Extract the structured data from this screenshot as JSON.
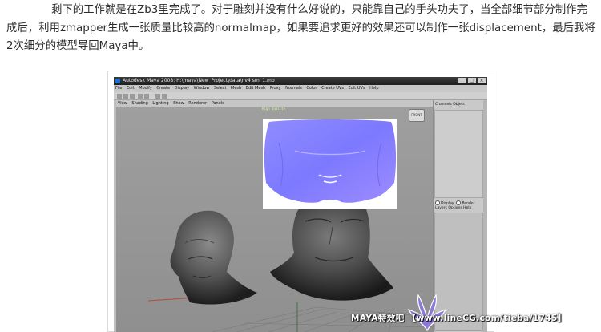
{
  "article": {
    "paragraph": "剩下的工作就是在Zb3里完成了。对于雕刻并没有什么好说的，只能靠自己的手头功夫了，当全部细节部分制作完成后，利用zmapper生成一张质量比较高的normalmap，如果要追求更好的效果还可以制作一张displacement，最后我将2次细分的模型导回Maya中。"
  },
  "maya": {
    "window_title": "Autodesk Maya 2008: H:\\maya\\New_Project\\data\\nv4 sml 1.mb",
    "window_buttons": [
      "_",
      "□",
      "×"
    ],
    "menus": [
      "File",
      "Edit",
      "Modify",
      "Create",
      "Display",
      "Window",
      "Select",
      "Mesh",
      "Edit Mesh",
      "Proxy",
      "Normals",
      "Color",
      "Create UVs",
      "Edit UVs",
      "Help"
    ],
    "panel_menus": [
      "View",
      "Shading",
      "Lighting",
      "Show",
      "Renderer",
      "Panels"
    ],
    "viewport_label": "High Quality",
    "viewcube_label": "FRONT",
    "side_tabs": [
      "Channels",
      "Object"
    ],
    "layer_tabs": [
      "Display",
      "Render"
    ],
    "layer_menus": [
      "Layers",
      "Options",
      "Help"
    ]
  },
  "watermark": {
    "text": "MAYA特效吧 【www.lineCG.com/tieba/1745】"
  },
  "colors": {
    "viewport_gray": "#8f8f8f",
    "normalmap_blue": "#7f7bff",
    "head_gray": "#5e5e5e"
  }
}
